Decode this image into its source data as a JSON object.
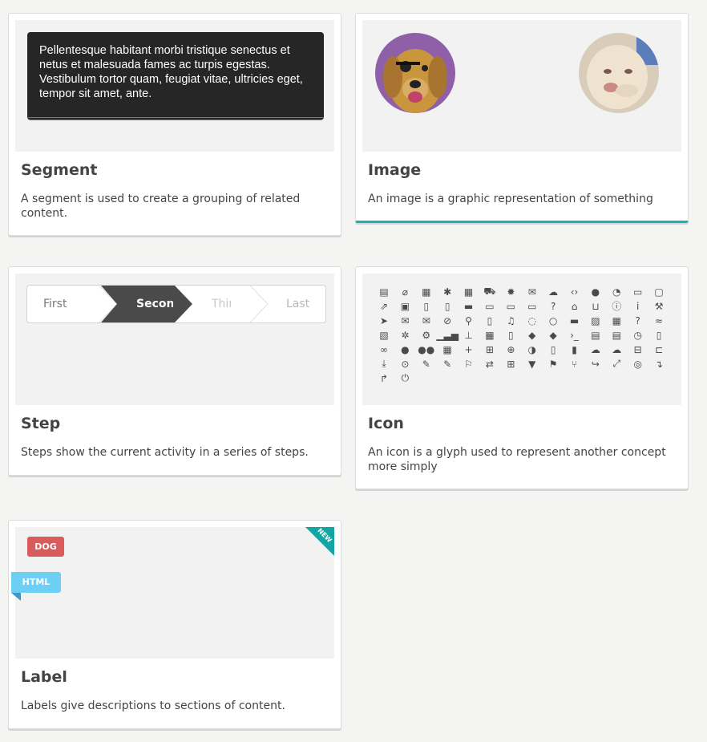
{
  "cards": [
    {
      "title": "Segment",
      "description": "A segment is used to create a grouping of related content.",
      "preview_text": "Pellentesque habitant morbi tristique senectus et netus et malesuada fames ac turpis egestas. Vestibulum tortor quam, feugiat vitae, ultricies eget, tempor sit amet, ante."
    },
    {
      "title": "Image",
      "description": "An image is a graphic representation of something",
      "active": true
    },
    {
      "title": "Step",
      "description": "Steps show the current activity in a series of steps.",
      "steps": [
        "First",
        "Second",
        "Third",
        "Last"
      ]
    },
    {
      "title": "Icon",
      "description": "An icon is a glyph used to represent another concept more simply"
    },
    {
      "title": "Label",
      "description": "Labels give descriptions to sections of content.",
      "labels": {
        "dog": "DOG",
        "html": "HTML",
        "corner": "NEW"
      }
    }
  ],
  "colors": {
    "teal": "#1ab0b4",
    "red_label": "#d95c5c",
    "blue_label": "#6ecff5",
    "dark": "#262626"
  },
  "icon_names": [
    "archive",
    "attachment",
    "browser",
    "bug",
    "calendar",
    "cart",
    "certificate",
    "chat",
    "cloud",
    "code",
    "comment",
    "dashboard",
    "desktop",
    "empty-calendar",
    "external",
    "facebook",
    "file",
    "file-outline",
    "folder",
    "folder-open",
    "folder-open-outline",
    "folder-outline",
    "help",
    "home",
    "inbox",
    "info",
    "letter-i",
    "legal",
    "location",
    "mail",
    "mail-outline",
    "compass",
    "map-marker",
    "mobile",
    "music",
    "chat-outline",
    "comment-outline",
    "payment",
    "photo",
    "qrcode",
    "question",
    "rss",
    "rss-sign",
    "setting",
    "settings",
    "signal",
    "sitemap",
    "table",
    "tablet",
    "tag",
    "tags",
    "terminal",
    "text-file",
    "text-file-outline",
    "time",
    "trash",
    "url",
    "user",
    "users",
    "video",
    "add",
    "add-sign",
    "add-circle",
    "adjust",
    "bookmark",
    "bookmark-solid",
    "cloud-download",
    "cloud-upload",
    "remove-sign",
    "crop",
    "download",
    "download-circle",
    "edit",
    "edit-sign",
    "flag-outline",
    "exchange",
    "add-small",
    "filter",
    "flag",
    "fork",
    "forward",
    "expand",
    "hide",
    "level-down",
    "level-up",
    "off"
  ]
}
